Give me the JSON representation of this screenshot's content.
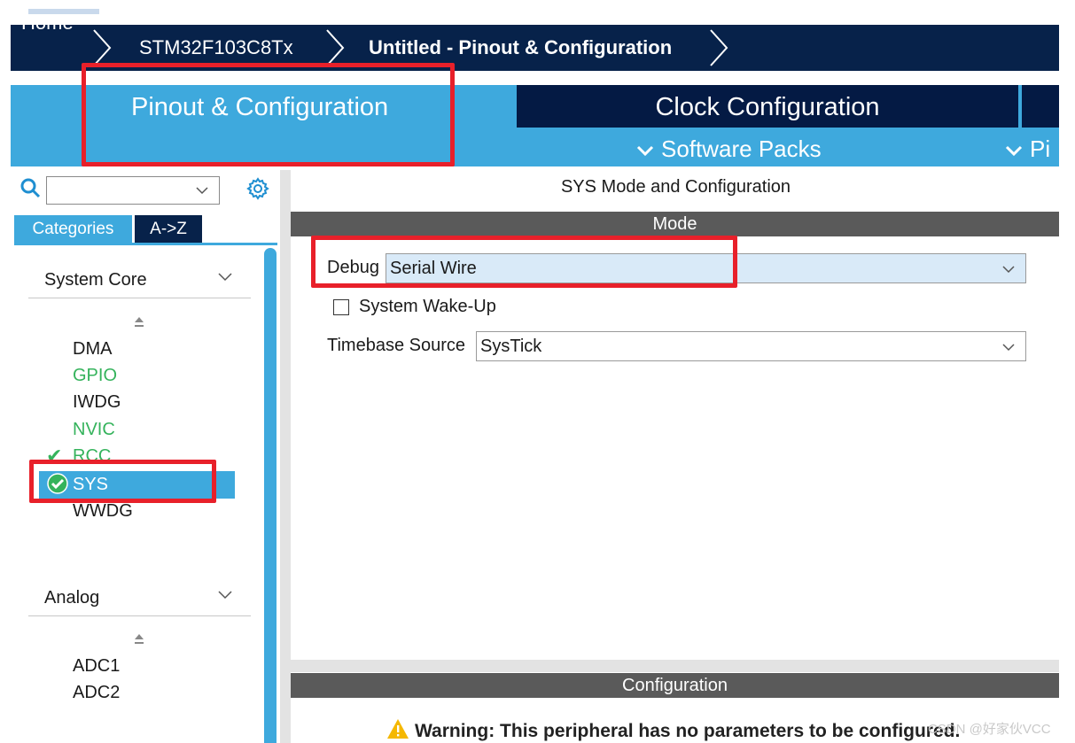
{
  "breadcrumb": {
    "items": [
      {
        "label": "Home"
      },
      {
        "label": "STM32F103C8Tx"
      },
      {
        "label": "Untitled - Pinout & Configuration"
      }
    ]
  },
  "tabs": {
    "pinout": "Pinout & Configuration",
    "clock": "Clock Configuration",
    "software_packs": "Software Packs",
    "pinout_view": "Pi"
  },
  "left": {
    "categories_tab": "Categories",
    "az_tab": "A->Z",
    "groups": [
      {
        "label": "System Core",
        "items": [
          "DMA",
          "GPIO",
          "IWDG",
          "NVIC",
          "RCC",
          "SYS",
          "WWDG"
        ]
      },
      {
        "label": "Analog",
        "items": [
          "ADC1",
          "ADC2"
        ]
      }
    ],
    "green_items": [
      "GPIO",
      "NVIC",
      "RCC"
    ],
    "selected_item": "SYS"
  },
  "right": {
    "title": "SYS Mode and Configuration",
    "mode_header": "Mode",
    "debug_label": "Debug",
    "debug_value": "Serial Wire",
    "wakeup_label": "System Wake-Up",
    "wakeup_checked": false,
    "timebase_label": "Timebase Source",
    "timebase_value": "SysTick",
    "config_header": "Configuration",
    "warning": "Warning: This peripheral has no parameters to be configured."
  },
  "watermark": "CSDN @好家伙VCC",
  "colors": {
    "navy": "#07224a",
    "accent_blue": "#3ea9dd",
    "highlight_red": "#e8202a",
    "green": "#35b35c"
  }
}
